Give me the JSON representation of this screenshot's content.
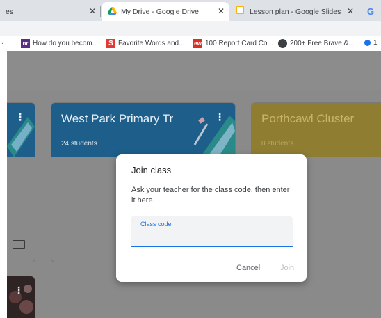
{
  "tabs": [
    {
      "label": "es",
      "icon": "none"
    },
    {
      "label": "My Drive - Google Drive",
      "icon": "google-drive-icon"
    },
    {
      "label": "Lesson plan - Google Slides",
      "icon": "google-slides-icon"
    },
    {
      "label": "G",
      "icon": "google-icon"
    }
  ],
  "bookmarks": [
    {
      "label": "How do you becom...",
      "icon": "nr-icon"
    },
    {
      "label": "Favorite Words and...",
      "icon": "s-icon"
    },
    {
      "label": "100 Report Card Co...",
      "icon": "ew-icon"
    },
    {
      "label": "200+ Free Brave &...",
      "icon": "globe-icon"
    },
    {
      "label": "1",
      "icon": "blue-dot-icon"
    }
  ],
  "bookmark_icon_text": {
    "nr": "nr",
    "s": "S",
    "ew": "ew"
  },
  "cards": [
    {
      "title": "West Park Primary Tr",
      "subtitle": "24 students"
    },
    {
      "title": "Porthcawl Cluster",
      "subtitle": "0 students"
    }
  ],
  "dialog": {
    "title": "Join class",
    "instructions": "Ask your teacher for the class code, then enter it here.",
    "field_label": "Class code",
    "field_value": "",
    "cancel_label": "Cancel",
    "join_label": "Join"
  },
  "colors": {
    "accent": "#1a73e8",
    "card_blue": "#1d5e8a",
    "card_yellow": "#8f7d32"
  }
}
